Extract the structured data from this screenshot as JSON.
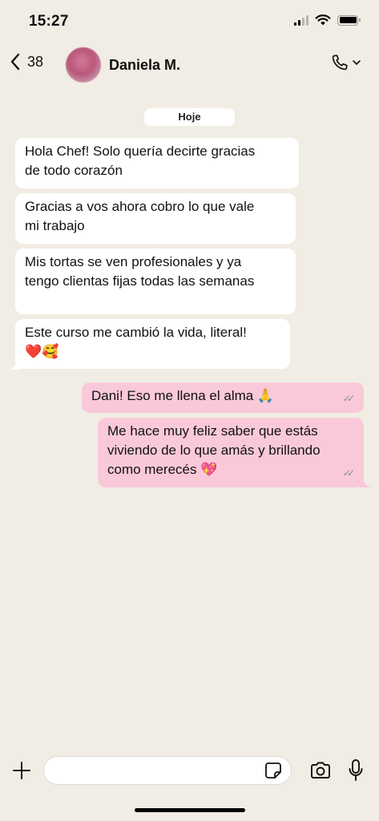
{
  "status": {
    "time": "15:27"
  },
  "header": {
    "back_count": "38",
    "contact_name": "Daniela M."
  },
  "chat": {
    "date_label": "Hoje",
    "incoming": [
      {
        "line1": "Hola Chef! Solo quería decirte gracias",
        "line2": "de todo corazón"
      },
      {
        "line1": "Gracias a vos ahora cobro lo que vale",
        "line2": "mi trabajo"
      },
      {
        "line1": "Mis tortas se ven profesionales y ya",
        "line2": "tengo clientas fijas todas las semanas"
      },
      {
        "line1": "Este curso me cambió la vida, literal!",
        "line2": "❤️🥰"
      }
    ],
    "outgoing": [
      {
        "text": "Dani! Eso me llena el alma 🙏"
      },
      {
        "line1": "Me hace muy feliz saber que estás",
        "line2": "viviendo de lo que amás y brillando",
        "line3": "como merecés 💖"
      }
    ]
  },
  "input": {
    "value": "",
    "placeholder": ""
  },
  "icons": {
    "back": "chevron-left-icon",
    "call": "phone-icon",
    "plus": "plus-icon",
    "sticker": "sticker-icon",
    "camera": "camera-icon",
    "mic": "microphone-icon"
  },
  "colors": {
    "background": "#f1ede4",
    "incoming_bubble": "#ffffff",
    "outgoing_bubble": "#f9c9d9"
  }
}
